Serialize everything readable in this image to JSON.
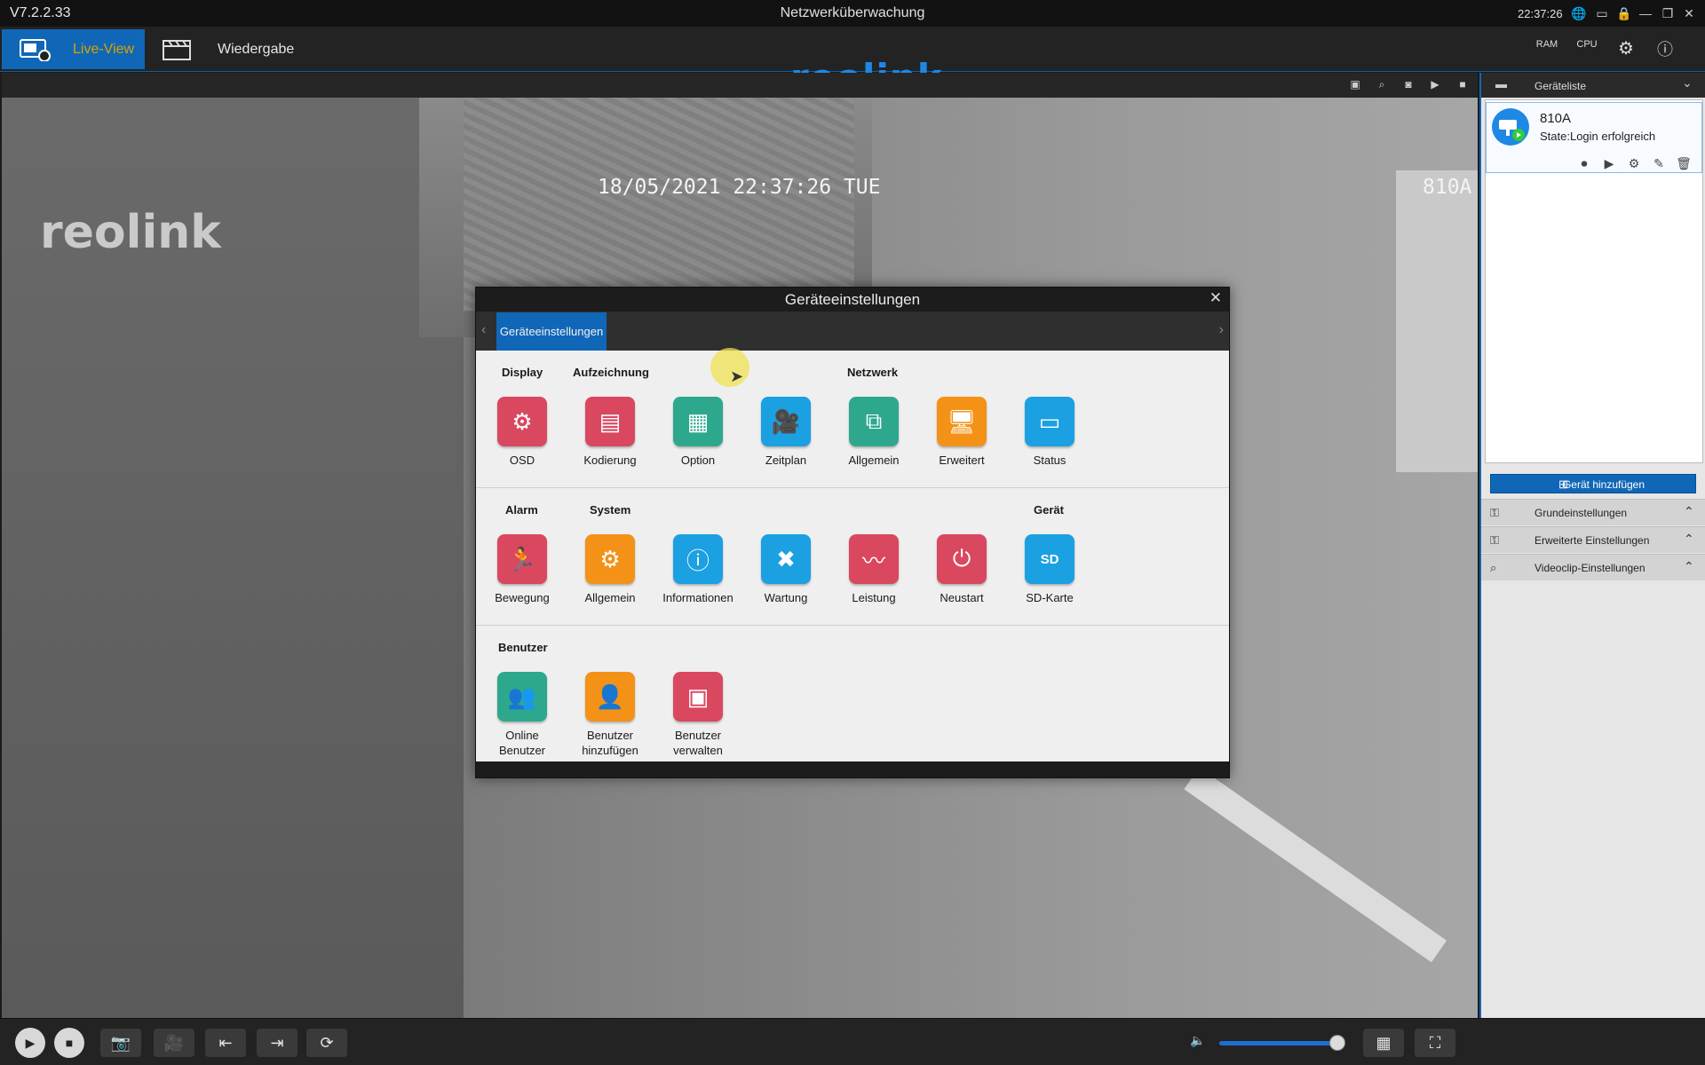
{
  "app": {
    "version": "V7.2.2.33",
    "title": "Netzwerküberwachung",
    "clock": "22:37:26",
    "logo": "reolink"
  },
  "nav": {
    "live_view": "Live-View",
    "playback": "Wiedergabe",
    "right_icons": [
      "RAM",
      "CPU"
    ]
  },
  "video": {
    "timestamp": "18/05/2021 22:37:26 TUE",
    "camera_name": "810A",
    "watermark": "reolink"
  },
  "device_panel": {
    "header": "Geräteliste",
    "device": {
      "name": "810A",
      "state": "State:Login erfolgreich"
    },
    "add_button": "Gerät hinzufügen",
    "accordions": [
      {
        "label": "Grundeinstellungen"
      },
      {
        "label": "Erweiterte Einstellungen"
      },
      {
        "label": "Videoclip-Einstellungen"
      }
    ]
  },
  "dialog": {
    "title": "Geräteeinstellungen",
    "tab": "Geräteeinstellungen",
    "sections": [
      {
        "labels": [
          {
            "text": "Display"
          },
          {
            "text": "Aufzeichnung"
          },
          {
            "text": "Netzwerk"
          }
        ],
        "items": [
          {
            "label": "OSD",
            "color": "#d9485f",
            "icon": "camera-sliders-icon"
          },
          {
            "label": "Kodierung",
            "color": "#d9485f",
            "icon": "encoding-icon"
          },
          {
            "label": "Option",
            "color": "#2ea88d",
            "icon": "grid-icon"
          },
          {
            "label": "Zeitplan",
            "color": "#1ba0e2",
            "icon": "video-camera-icon"
          },
          {
            "label": "Allgemein",
            "color": "#2ea88d",
            "icon": "network-icon"
          },
          {
            "label": "Erweitert",
            "color": "#f39217",
            "icon": "monitor-gear-icon"
          },
          {
            "label": "Status",
            "color": "#1ba0e2",
            "icon": "monitor-icon"
          }
        ]
      },
      {
        "labels": [
          {
            "text": "Alarm"
          },
          {
            "text": "System"
          },
          {
            "text": "Gerät"
          }
        ],
        "items": [
          {
            "label": "Bewegung",
            "color": "#d9485f",
            "icon": "running-person-icon"
          },
          {
            "label": "Allgemein",
            "color": "#f39217",
            "icon": "gear-icon"
          },
          {
            "label": "Informationen",
            "color": "#1ba0e2",
            "icon": "info-icon"
          },
          {
            "label": "Wartung",
            "color": "#1ba0e2",
            "icon": "tools-icon"
          },
          {
            "label": "Leistung",
            "color": "#d9485f",
            "icon": "waveform-icon"
          },
          {
            "label": "Neustart",
            "color": "#d9485f",
            "icon": "power-icon"
          },
          {
            "label": "SD-Karte",
            "color": "#1ba0e2",
            "icon": "sd-card-icon"
          }
        ]
      },
      {
        "labels": [
          {
            "text": "Benutzer"
          }
        ],
        "items": [
          {
            "label": "Online Benutzer",
            "color": "#2ea88d",
            "icon": "users-icon"
          },
          {
            "label": "Benutzer hinzufügen",
            "color": "#f39217",
            "icon": "add-user-icon"
          },
          {
            "label": "Benutzer verwalten",
            "color": "#d9485f",
            "icon": "manage-users-icon"
          }
        ]
      }
    ]
  }
}
